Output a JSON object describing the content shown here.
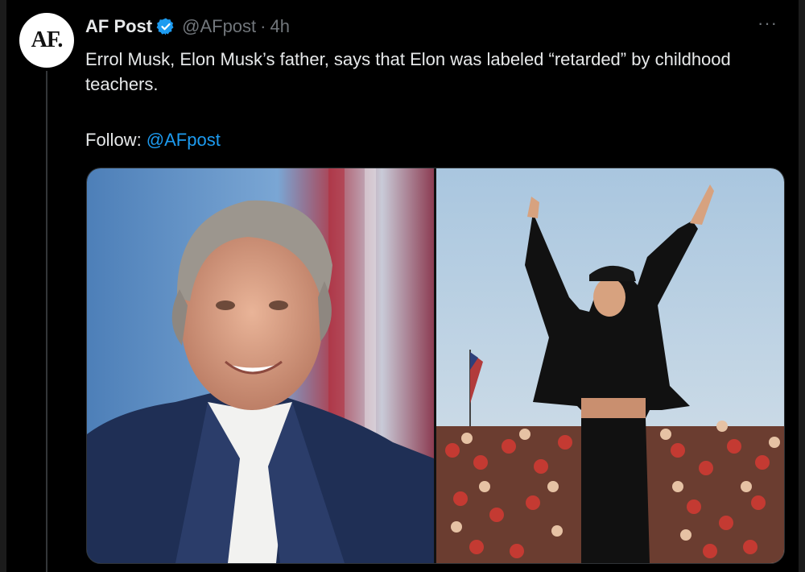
{
  "tweet": {
    "avatar_text": "AF.",
    "display_name": "AF Post",
    "handle": "@AFpost",
    "separator": "·",
    "time": "4h",
    "more": "···",
    "text": "Errol Musk, Elon Musk’s father, says that Elon was labeled “retarded” by childhood teachers.",
    "follow_label": "Follow: ",
    "follow_mention": "@AFpost"
  },
  "colors": {
    "background": "#000000",
    "text": "#e7e9ea",
    "muted": "#71767b",
    "link": "#1d9bf0",
    "verified": "#1d9bf0"
  },
  "icons": {
    "verified": "verified-badge-icon",
    "more": "more-horizontal-icon"
  }
}
